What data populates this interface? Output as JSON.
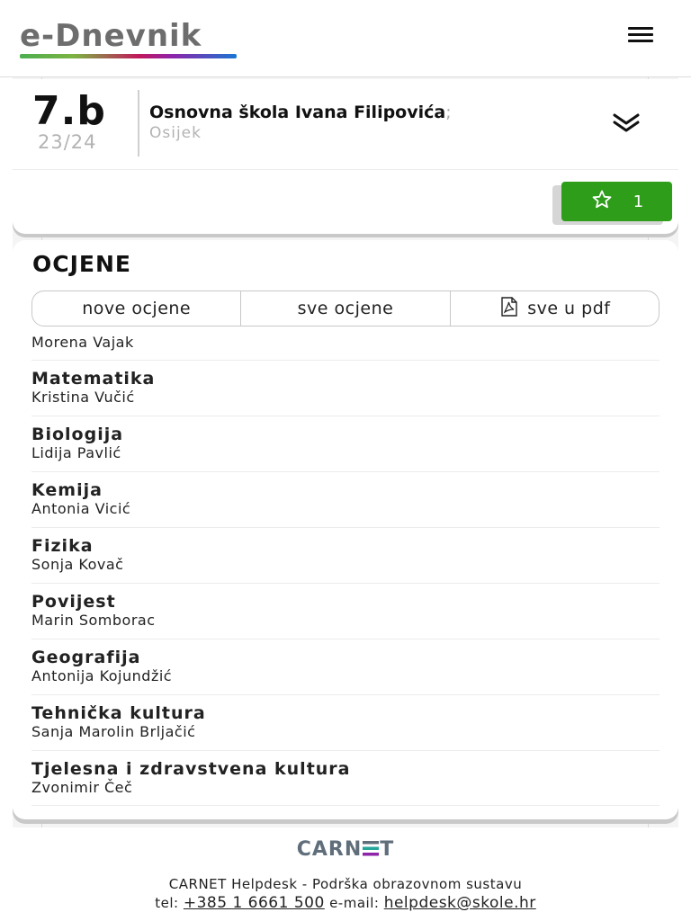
{
  "header": {
    "logo_text": "e-Dnevnik",
    "menu_icon": "hamburger-icon"
  },
  "class_card": {
    "class_name": "7.b",
    "school_year": "23/24",
    "school_name": "Osnovna škola Ivana Filipovića",
    "school_separator": ";",
    "city": "Osijek",
    "expand_icon": "chevron-double-down-icon",
    "star_icon": "star-outline-icon",
    "star_count": "1",
    "colors": {
      "star_button": "#2e9d1a"
    }
  },
  "grades": {
    "title": "OCJENE",
    "tabs": [
      {
        "label": "nove ocjene"
      },
      {
        "label": "sve ocjene"
      },
      {
        "label": "sve u pdf",
        "icon": "pdf-icon"
      }
    ],
    "partial_teacher": "Morena Vajak",
    "subjects": [
      {
        "name": "Matematika",
        "teacher": "Kristina Vučić"
      },
      {
        "name": "Biologija",
        "teacher": "Lidija Pavlić"
      },
      {
        "name": "Kemija",
        "teacher": "Antonia Vicić"
      },
      {
        "name": "Fizika",
        "teacher": "Sonja Kovač"
      },
      {
        "name": "Povijest",
        "teacher": "Marin Somborac"
      },
      {
        "name": "Geografija",
        "teacher": "Antonija Kojundžić"
      },
      {
        "name": "Tehnička kultura",
        "teacher": "Sanja Marolin Brljačić"
      },
      {
        "name": "Tjelesna i zdravstvena kultura",
        "teacher": "Zvonimir Čeč"
      }
    ]
  },
  "footer": {
    "carnet_left": "CARN",
    "carnet_right": "T",
    "helpdesk_text": "CARNET Helpdesk - Podrška obrazovnom sustavu",
    "tel_label": "tel:",
    "tel_value": "+385 1 6661 500",
    "email_label": "e-mail:",
    "email_value": "helpdesk@skole.hr"
  }
}
